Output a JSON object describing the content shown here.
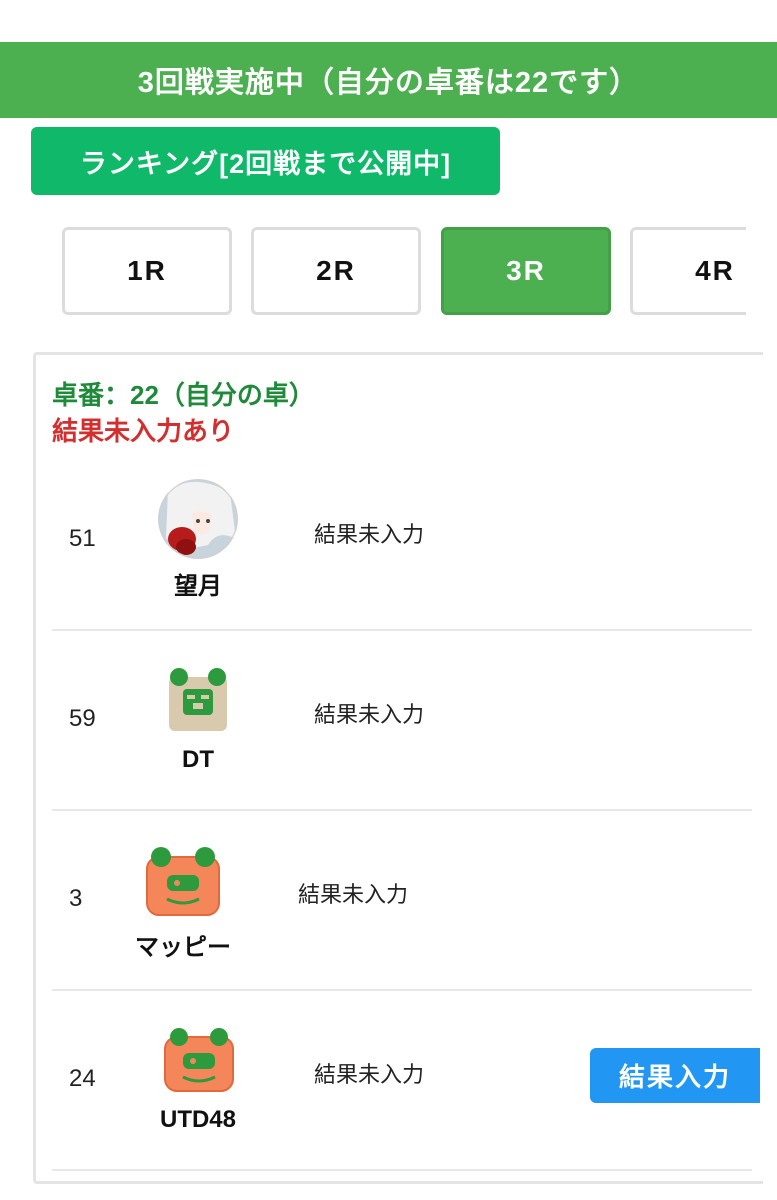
{
  "banner": {
    "text": "3回戦実施中（自分の卓番は22です）"
  },
  "ranking_button": {
    "label": "ランキング[2回戦まで公開中]"
  },
  "round_tabs": [
    {
      "label": "1R",
      "active": false
    },
    {
      "label": "2R",
      "active": false
    },
    {
      "label": "3R",
      "active": true
    },
    {
      "label": "4R",
      "active": false
    }
  ],
  "table_card": {
    "table_label": "卓番：22（自分の卓）",
    "warning": "結果未入力あり",
    "players": [
      {
        "number": "51",
        "name": "望月",
        "avatar": "anime-girl-avatar",
        "status": "結果未入力"
      },
      {
        "number": "59",
        "name": "DT",
        "avatar": "beige-bear-avatar",
        "status": "結果未入力"
      },
      {
        "number": "3",
        "name": "マッピー",
        "avatar": "orange-bear-avatar",
        "status": "結果未入力"
      },
      {
        "number": "24",
        "name": "UTD48",
        "avatar": "orange-bear-avatar",
        "status": "結果未入力"
      }
    ],
    "result_button": {
      "label": "結果入力"
    }
  },
  "colors": {
    "banner_green": "#4caf50",
    "ranking_green": "#10b96a",
    "table_label_green": "#1f8a3a",
    "warning_red": "#d32f2f",
    "result_button_blue": "#2196f3"
  }
}
